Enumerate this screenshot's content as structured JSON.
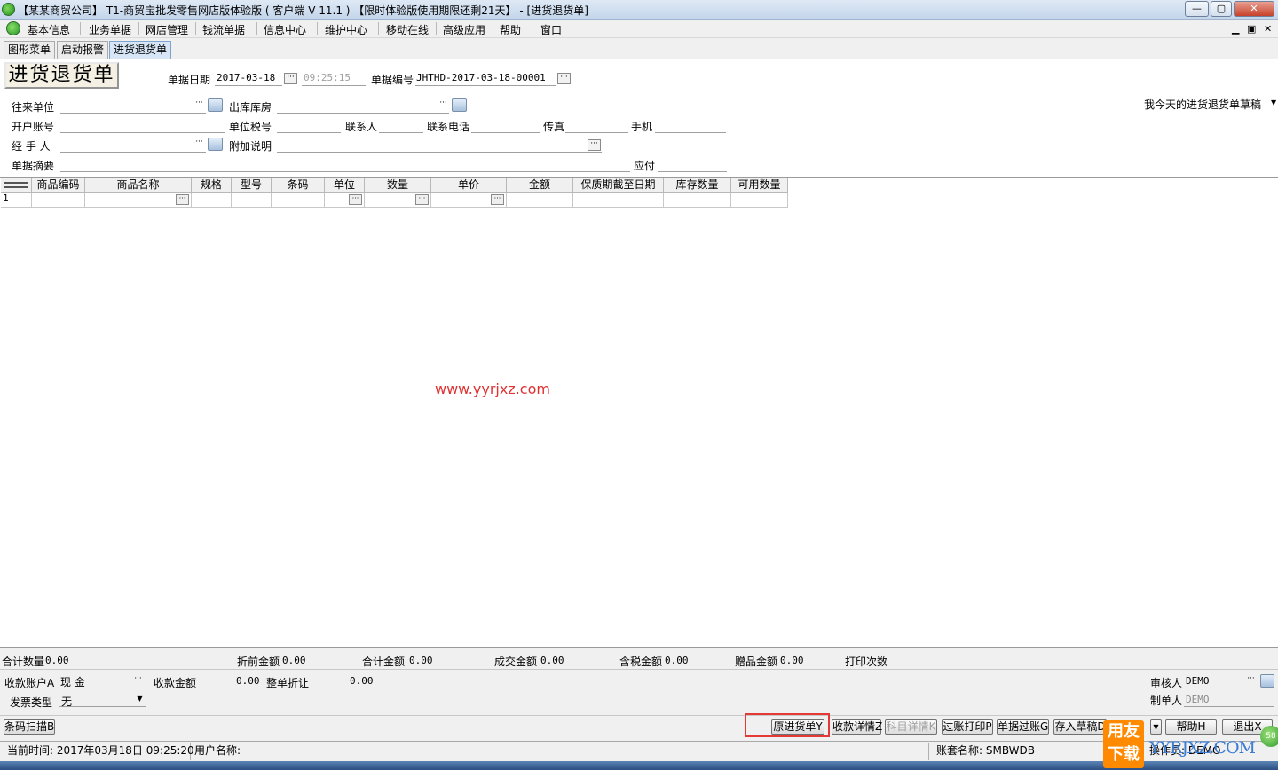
{
  "window": {
    "title": "【某某商贸公司】 T1-商贸宝批发零售网店版体验版 ( 客户端 V 11.1 ) 【限时体验版使用期限还剩21天】 - [进货退货单]",
    "controls": [
      "—",
      "▢",
      "✕"
    ]
  },
  "menu": {
    "items": [
      "基本信息",
      "业务单据",
      "网店管理",
      "钱流单据",
      "信息中心",
      "维护中心",
      "移动在线",
      "高级应用",
      "帮助",
      "窗口"
    ],
    "mdi_controls": [
      "▁",
      "▣",
      "✕"
    ]
  },
  "tabs": [
    "图形菜单",
    "启动报警",
    "进货退货单"
  ],
  "doc": {
    "title": "进货退货单",
    "date_label": "单据日期",
    "date_value": "2017-03-18",
    "time_value": "09:25:15",
    "number_label": "单据编号",
    "number_value": "JHTHD-2017-03-18-00001",
    "draft_select": "我今天的进货退货单草稿"
  },
  "fields": {
    "partner": "往来单位",
    "warehouse": "出库库房",
    "bank_account": "开户账号",
    "tax_no": "单位税号",
    "contact": "联系人",
    "phone": "联系电话",
    "fax": "传真",
    "mobile": "手机",
    "handler": "经 手 人",
    "remark": "附加说明",
    "summary": "单据摘要",
    "payable": "应付"
  },
  "grid": {
    "columns": [
      "商品编码",
      "商品名称",
      "规格",
      "型号",
      "条码",
      "单位",
      "数量",
      "单价",
      "金额",
      "保质期截至日期",
      "库存数量",
      "可用数量"
    ],
    "row_number": "1"
  },
  "watermark": "www.yyrjxz.com",
  "totals": {
    "total_qty": "合计数量",
    "total_qty_value": "0.00",
    "pre_discount": "折前金额",
    "pre_discount_value": "0.00",
    "total_amount": "合计金额",
    "total_amount_value": "0.00",
    "deal_amount": "成交金额",
    "deal_amount_value": "0.00",
    "tax_amount": "含税金额",
    "tax_amount_value": "0.00",
    "gift_amount": "赠品金额",
    "gift_amount_value": "0.00",
    "print_count": "打印次数"
  },
  "payment": {
    "account_label": "收款账户A",
    "account_value": "现      金",
    "amount_label": "收款金额",
    "amount_value": "0.00",
    "discount_label": "整单折让",
    "discount_value": "0.00",
    "invoice_label": "发票类型",
    "invoice_value": "无",
    "reviewer_label": "审核人",
    "reviewer_value": "DEMO",
    "maker_label": "制单人",
    "maker_value": "DEMO"
  },
  "buttons": {
    "barcode": "条码扫描B",
    "original": "原进货单Y",
    "collect_detail": "收款详情Z",
    "subject_detail": "科目详情K",
    "post_print": "过账打印P",
    "post_doc": "单据过账G",
    "save_draft": "存入草稿D",
    "help": "帮助H",
    "exit": "退出X"
  },
  "status": {
    "current_time": "当前时间: 2017年03月18日 09:25:20",
    "user": "用户名称:",
    "account_set": "账套名称: SMBWDB",
    "operator": "操作员: DEMO"
  },
  "brand": {
    "logo_text": "用友\n下载",
    "site": "YYRJXZ.COM",
    "ball": "58"
  }
}
